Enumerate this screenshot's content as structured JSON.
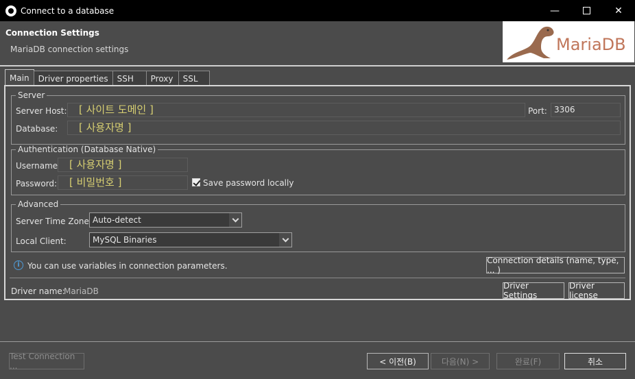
{
  "window": {
    "title": "Connect to a database"
  },
  "header": {
    "title": "Connection Settings",
    "subtitle": "MariaDB connection settings",
    "logo_text": "MariaDB"
  },
  "tabs": [
    "Main",
    "Driver properties",
    "SSH",
    "Proxy",
    "SSL"
  ],
  "server": {
    "legend": "Server",
    "host_label": "Server Host:",
    "host_value": "[ 사이트 도메인 ]",
    "port_label": "Port:",
    "port_value": "3306",
    "database_label": "Database:",
    "database_value": "[ 사용자명 ]"
  },
  "auth": {
    "legend": "Authentication (Database Native)",
    "username_label": "Username:",
    "username_value": "[ 사용자명 ]",
    "password_label": "Password:",
    "password_value": "[ 비밀번호 ]",
    "save_password_label": "Save password locally",
    "save_password_checked": true
  },
  "advanced": {
    "legend": "Advanced",
    "timezone_label": "Server Time Zone:",
    "timezone_value": "Auto-detect",
    "client_label": "Local Client:",
    "client_value": "MySQL Binaries"
  },
  "info": {
    "text": "You can use variables in connection parameters.",
    "details_button": "Connection details (name, type, ... )"
  },
  "driver": {
    "name_label": "Driver name:",
    "name_value": "MariaDB",
    "settings_button": "Driver Settings",
    "license_button": "Driver license"
  },
  "footer": {
    "test_button": "Test Connection ...",
    "back_button": "< 이전(B)",
    "next_button": "다음(N) >",
    "finish_button": "완료(F)",
    "cancel_button": "취소"
  },
  "colors": {
    "accent_placeholder": "#d7cf72",
    "info_icon": "#4f9ad6",
    "logo_text": "#c0765a"
  },
  "icons": {
    "app": "dbeaver-icon",
    "info": "info-icon",
    "check": "checkmark-icon",
    "dropdown": "chevron-down-icon"
  }
}
